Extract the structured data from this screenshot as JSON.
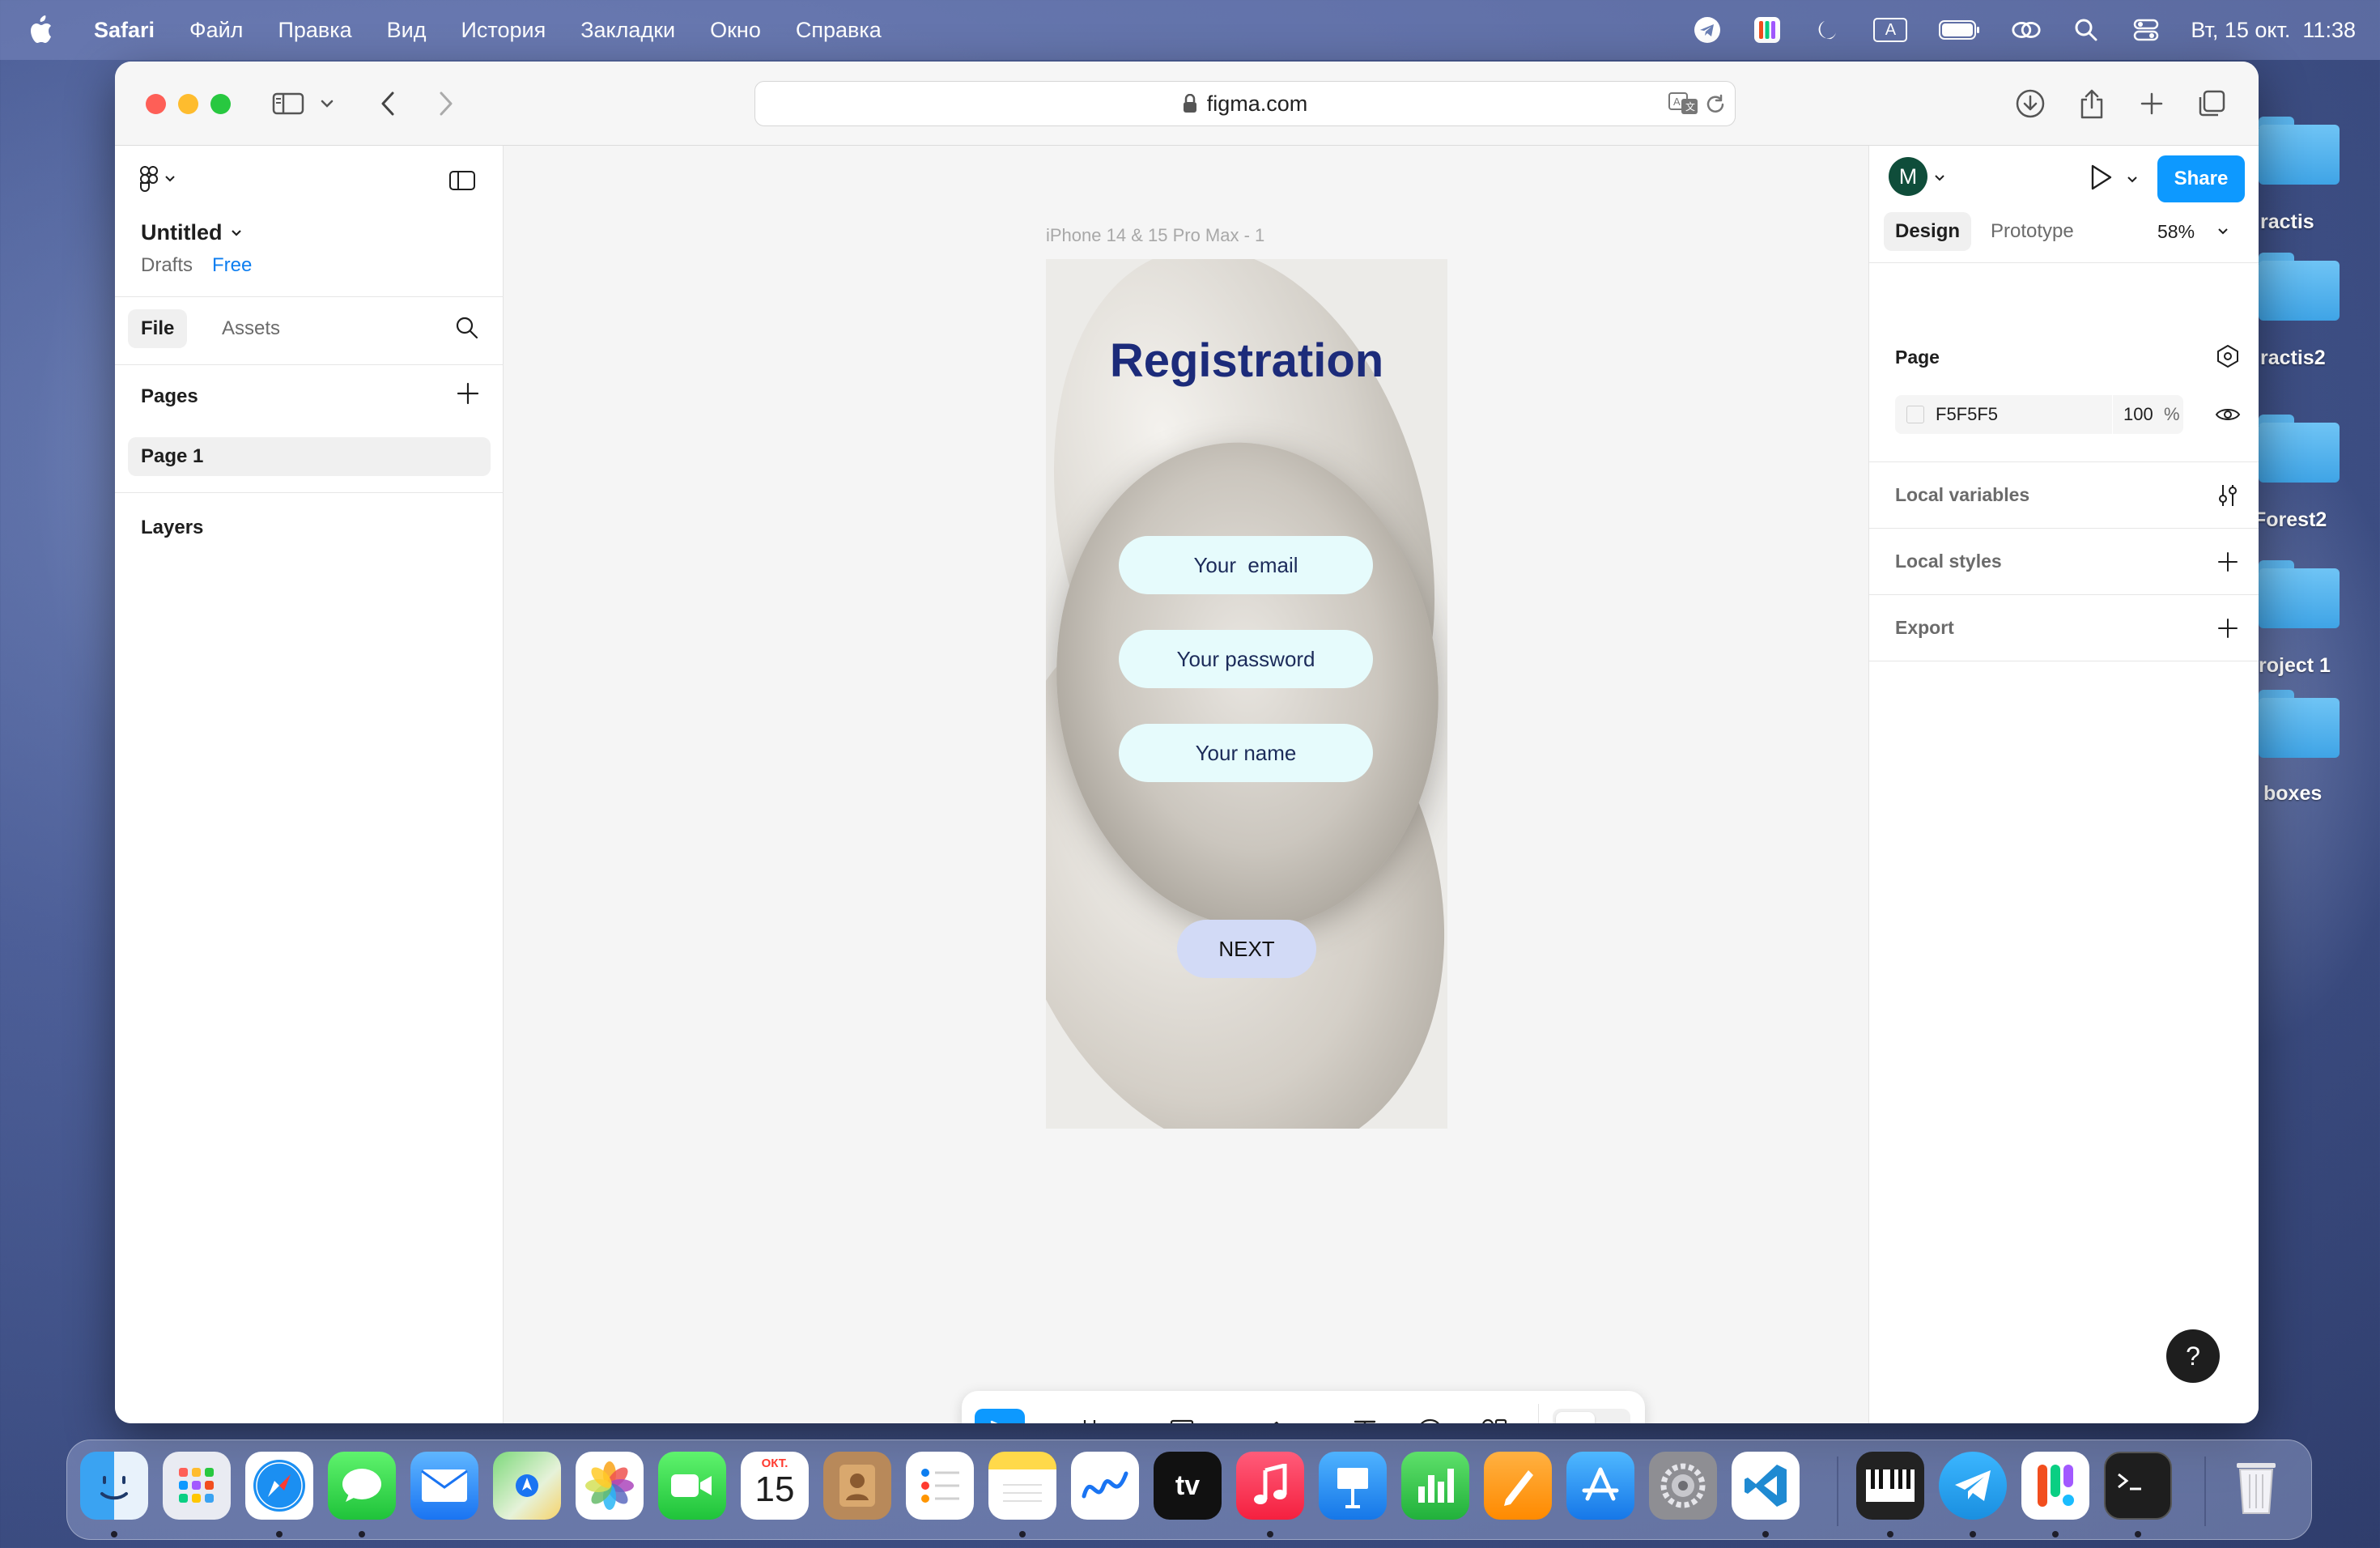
{
  "menubar": {
    "app_name": "Safari",
    "items": [
      "Файл",
      "Правка",
      "Вид",
      "История",
      "Закладки",
      "Окно",
      "Справка"
    ],
    "keyboard_layout": "A",
    "datetime": "Вт, 15 окт.  11:38"
  },
  "desktop": {
    "folders": [
      "ractis",
      "ractis2",
      "Forest2",
      "roject 1",
      "boxes"
    ]
  },
  "browser": {
    "url": "figma.com"
  },
  "figma": {
    "file": {
      "name": "Untitled",
      "location": "Drafts",
      "plan": "Free"
    },
    "left_tabs": {
      "file": "File",
      "assets": "Assets"
    },
    "pages_heading": "Pages",
    "pages": [
      "Page 1"
    ],
    "layers_heading": "Layers",
    "canvas": {
      "frame_label": "iPhone 14 & 15 Pro Max - 1",
      "screen": {
        "title": "Registration",
        "inputs": [
          "Your  email",
          "Your password",
          "Your name"
        ],
        "button": "NEXT"
      }
    },
    "right": {
      "avatar_initial": "M",
      "share_label": "Share",
      "tabs": [
        "Design",
        "Prototype"
      ],
      "active_tab": "Design",
      "zoom": "58%",
      "page_heading": "Page",
      "bg_color_hex": "F5F5F5",
      "bg_opacity": "100",
      "opacity_unit": "%",
      "sections": [
        "Local variables",
        "Local styles",
        "Export"
      ]
    },
    "help_label": "?"
  },
  "dock": {
    "calendar_month": "ОКТ.",
    "calendar_day": "15",
    "apps": [
      "finder",
      "launchpad",
      "safari",
      "messages",
      "mail",
      "maps",
      "photos",
      "facetime",
      "calendar",
      "contacts",
      "reminders",
      "notes",
      "freeform",
      "tv",
      "music",
      "keynote",
      "numbers",
      "pages",
      "app-store",
      "system-settings",
      "vscode",
      "piano",
      "telegram",
      "figma",
      "terminal",
      "trash"
    ],
    "tv_label": "tv"
  },
  "colors": {
    "figma_blue": "#0d99ff",
    "title_navy": "#1c2b7a",
    "input_fill": "#e6fbfc",
    "next_fill": "#d2daf6"
  }
}
